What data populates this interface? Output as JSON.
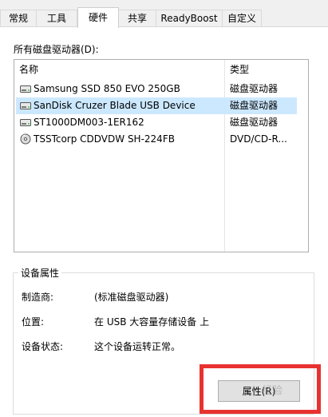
{
  "tabs": [
    {
      "label": "常规"
    },
    {
      "label": "工具"
    },
    {
      "label": "硬件"
    },
    {
      "label": "共享"
    },
    {
      "label": "ReadyBoost"
    },
    {
      "label": "自定义"
    }
  ],
  "active_tab": "硬件",
  "device_list": {
    "label": "所有磁盘驱动器(D):",
    "columns": {
      "name": "名称",
      "type": "类型"
    },
    "rows": [
      {
        "name": "Samsung SSD 850 EVO 250GB",
        "type": "磁盘驱动器",
        "icon": "disk-drive-icon"
      },
      {
        "name": "SanDisk Cruzer Blade USB Device",
        "type": "磁盘驱动器",
        "icon": "disk-drive-icon",
        "selected": true
      },
      {
        "name": "ST1000DM003-1ER162",
        "type": "磁盘驱动器",
        "icon": "disk-drive-icon"
      },
      {
        "name": "TSSTcorp CDDVDW SH-224FB",
        "type": "DVD/CD-R...",
        "icon": "optical-drive-icon"
      }
    ]
  },
  "device_properties": {
    "title": "设备属性",
    "manufacturer_label": "制造商:",
    "manufacturer_value": "(标准磁盘驱动器)",
    "location_label": "位置:",
    "location_value": "在 USB 大容量存储设备 上",
    "status_label": "设备状态:",
    "status_value": "这个设备运转正常。",
    "properties_button": "属性(R)"
  },
  "colors": {
    "selection": "#cce8ff",
    "highlight_annotation": "#e8322f"
  },
  "watermark_text": "经验"
}
